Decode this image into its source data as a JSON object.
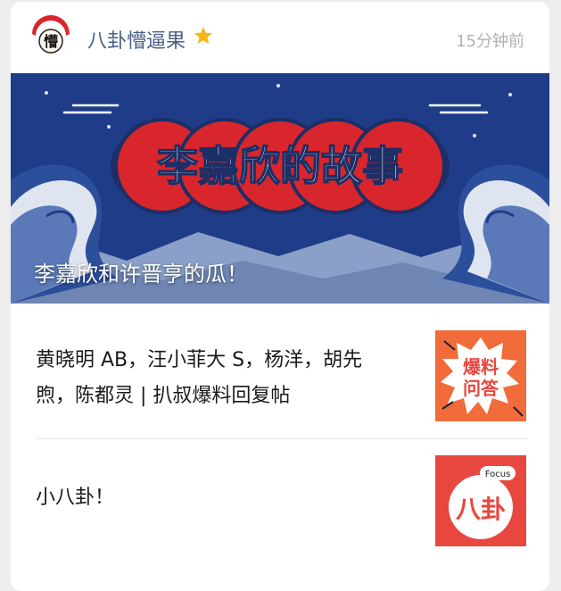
{
  "header": {
    "account_name": "八卦懵逼果",
    "post_time": "15分钟前",
    "avatar_text": "懵"
  },
  "banner": {
    "headline": "李嘉欣的故事",
    "caption": "李嘉欣和许晋亨的瓜！"
  },
  "articles": [
    {
      "title_line1": "黄晓明 AB，汪小菲大 S，杨洋，胡先",
      "title_line2": "煦，陈都灵 | 扒叔爆料回复帖",
      "thumb_text": "爆料问答"
    },
    {
      "title_line1": "小八卦！",
      "thumb_tag": "Focus",
      "thumb_text": "八卦"
    }
  ],
  "colors": {
    "account_name": "#4a5f88",
    "banner_navy": "#1f3c88",
    "banner_red": "#d8262c",
    "thumb_orange": "#f26b3a",
    "thumb_red": "#e8473f"
  }
}
